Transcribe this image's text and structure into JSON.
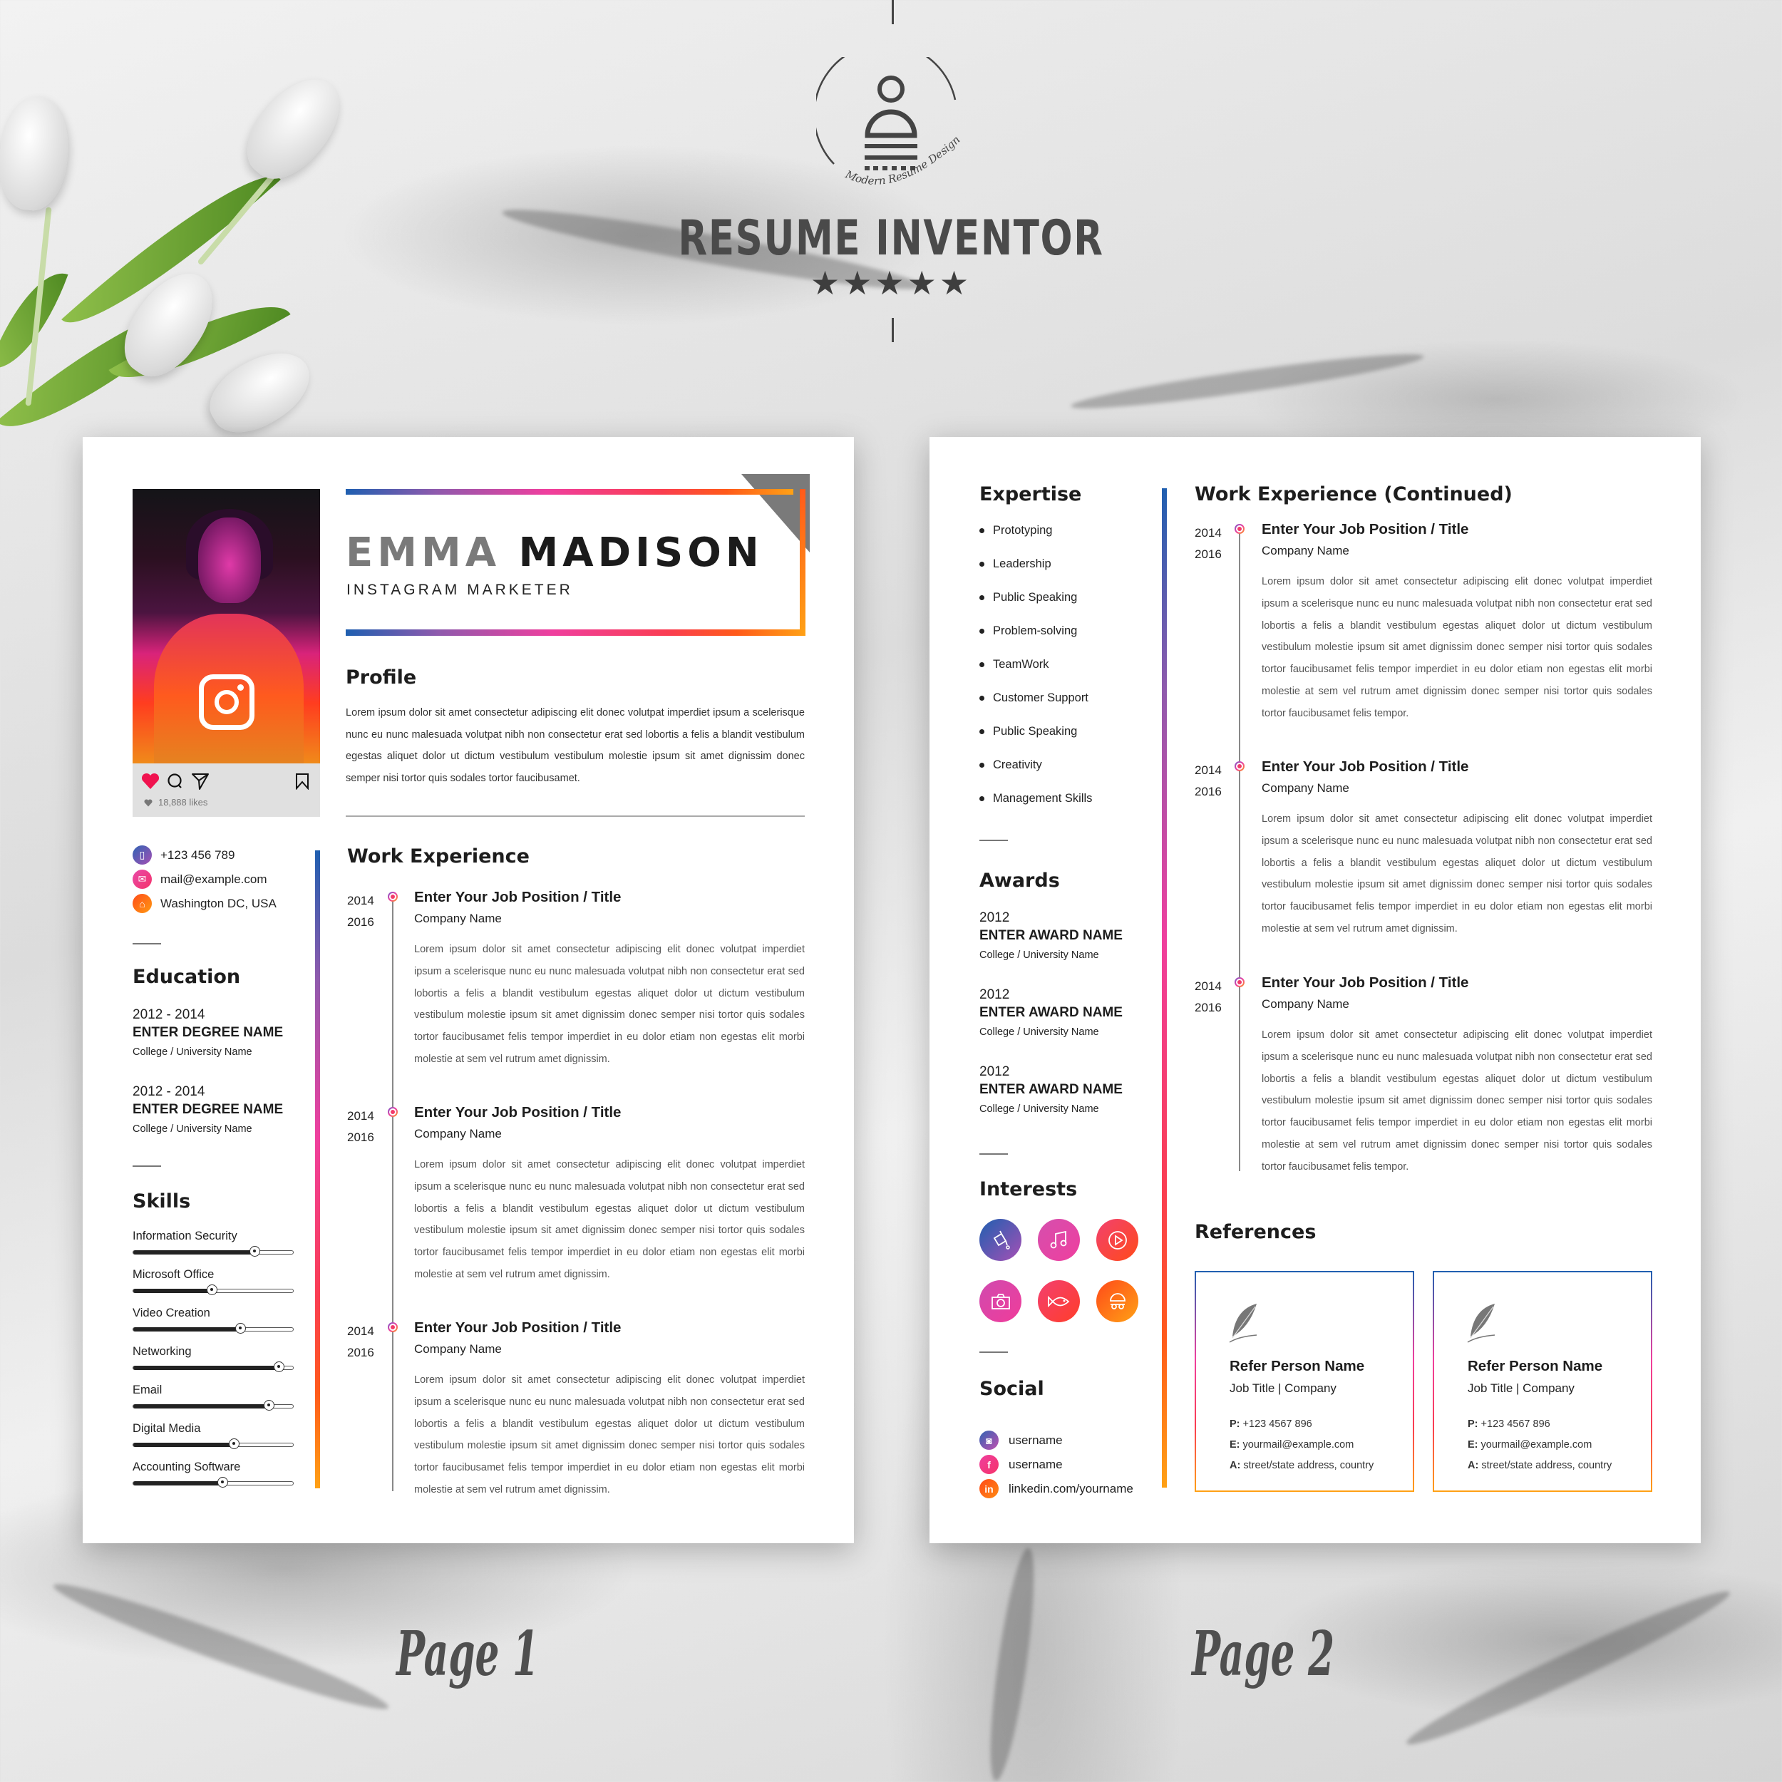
{
  "brand": {
    "logo_tagline": "Modern Resume Design",
    "title": "RESUME INVENTOR",
    "stars": "★★★★★",
    "rating": 5
  },
  "page_labels": [
    "Page 1",
    "Page 2"
  ],
  "page1": {
    "name_first": "EMMA",
    "name_last": "MADISON",
    "role": "INSTAGRAM MARKETER",
    "photo_card": {
      "likes": "18,888 likes",
      "icons": [
        "heart-icon",
        "comment-icon",
        "send-icon",
        "bookmark-icon"
      ]
    },
    "profile": {
      "heading": "Profile",
      "text": "Lorem ipsum dolor sit amet consectetur adipiscing elit donec volutpat imperdiet ipsum a scelerisque nunc eu nunc malesuada volutpat nibh non consectetur erat sed lobortis a felis a blandit vestibulum egestas aliquet dolor ut dictum vestibulum vestibulum molestie ipsum sit amet dignissim donec semper nisi tortor quis sodales tortor faucibusamet."
    },
    "contact": [
      {
        "icon": "phone-icon",
        "text": "+123 456 789"
      },
      {
        "icon": "mail-icon",
        "text": "mail@example.com"
      },
      {
        "icon": "home-icon",
        "text": "Washington DC, USA"
      }
    ],
    "education": {
      "heading": "Education",
      "items": [
        {
          "years": "2012 - 2014",
          "degree": "ENTER DEGREE NAME",
          "school": "College / University Name"
        },
        {
          "years": "2012 - 2014",
          "degree": "ENTER DEGREE NAME",
          "school": "College / University Name"
        }
      ]
    },
    "skills": {
      "heading": "Skills",
      "items": [
        {
          "label": "Information Security",
          "level_pct": 76
        },
        {
          "label": "Microsoft Office",
          "level_pct": 49
        },
        {
          "label": "Video Creation",
          "level_pct": 67
        },
        {
          "label": "Networking",
          "level_pct": 91
        },
        {
          "label": "Email",
          "level_pct": 85
        },
        {
          "label": "Digital Media",
          "level_pct": 63
        },
        {
          "label": "Accounting Software",
          "level_pct": 56
        }
      ]
    },
    "work": {
      "heading": "Work Experience",
      "jobs": [
        {
          "start": "2014",
          "end": "2016",
          "title": "Enter Your Job Position / Title",
          "company": "Company Name",
          "desc": "Lorem ipsum dolor sit amet consectetur adipiscing elit donec volutpat imperdiet ipsum a scelerisque nunc eu nunc malesuada volutpat nibh non consectetur erat sed lobortis a felis a blandit vestibulum egestas aliquet dolor ut dictum vestibulum vestibulum molestie ipsum sit amet dignissim donec semper nisi tortor quis sodales tortor faucibusamet felis tempor imperdiet in eu dolor etiam non egestas elit morbi molestie at sem vel rutrum amet dignissim."
        },
        {
          "start": "2014",
          "end": "2016",
          "title": "Enter Your Job Position / Title",
          "company": "Company Name",
          "desc": "Lorem ipsum dolor sit amet consectetur adipiscing elit donec volutpat imperdiet ipsum a scelerisque nunc eu nunc malesuada volutpat nibh non consectetur erat sed lobortis a felis a blandit vestibulum egestas aliquet dolor ut dictum vestibulum vestibulum molestie ipsum sit amet dignissim donec semper nisi tortor quis sodales tortor faucibusamet felis tempor imperdiet in eu dolor etiam non egestas elit morbi molestie at sem vel rutrum amet dignissim."
        },
        {
          "start": "2014",
          "end": "2016",
          "title": "Enter Your Job Position / Title",
          "company": "Company Name",
          "desc": "Lorem ipsum dolor sit amet consectetur adipiscing elit donec volutpat imperdiet ipsum a scelerisque nunc eu nunc malesuada volutpat nibh non consectetur erat sed lobortis a felis a blandit vestibulum egestas aliquet dolor ut dictum vestibulum vestibulum molestie ipsum sit amet dignissim donec semper nisi tortor quis sodales tortor faucibusamet felis tempor imperdiet in eu dolor etiam non egestas elit morbi molestie at sem vel rutrum amet dignissim."
        }
      ]
    }
  },
  "page2": {
    "expertise": {
      "heading": "Expertise",
      "items": [
        "Prototyping",
        "Leadership",
        "Public Speaking",
        "Problem-solving",
        "TeamWork",
        "Customer Support",
        "Public Speaking",
        "Creativity",
        "Management Skills"
      ]
    },
    "awards": {
      "heading": "Awards",
      "items": [
        {
          "year": "2012",
          "name": "ENTER AWARD NAME",
          "school": "College / University Name"
        },
        {
          "year": "2012",
          "name": "ENTER AWARD NAME",
          "school": "College / University Name"
        },
        {
          "year": "2012",
          "name": "ENTER AWARD NAME",
          "school": "College / University Name"
        }
      ]
    },
    "interests": {
      "heading": "Interests",
      "icons": [
        "paint-bucket-icon",
        "music-note-icon",
        "play-icon",
        "camera-icon",
        "fish-icon",
        "swimming-icon"
      ]
    },
    "social": {
      "heading": "Social",
      "items": [
        {
          "icon": "instagram-icon",
          "text": "username"
        },
        {
          "icon": "facebook-icon",
          "text": "username"
        },
        {
          "icon": "linkedin-icon",
          "text": "linkedin.com/yourname"
        }
      ]
    },
    "work": {
      "heading": "Work Experience (Continued)",
      "jobs": [
        {
          "start": "2014",
          "end": "2016",
          "title": "Enter Your Job Position / Title",
          "company": "Company Name",
          "desc": "Lorem ipsum dolor sit amet consectetur adipiscing elit donec volutpat imperdiet ipsum a scelerisque nunc eu nunc malesuada volutpat nibh non consectetur erat sed lobortis a felis a blandit vestibulum egestas aliquet dolor ut dictum vestibulum vestibulum molestie ipsum sit amet dignissim donec semper nisi tortor quis sodales tortor faucibusamet felis tempor imperdiet in eu dolor etiam non egestas elit morbi molestie at sem vel rutrum amet dignissim donec semper nisi tortor quis sodales tortor faucibusamet felis tempor."
        },
        {
          "start": "2014",
          "end": "2016",
          "title": "Enter Your Job Position / Title",
          "company": "Company Name",
          "desc": "Lorem ipsum dolor sit amet consectetur adipiscing elit donec volutpat imperdiet ipsum a scelerisque nunc eu nunc malesuada volutpat nibh non consectetur erat sed lobortis a felis a blandit vestibulum egestas aliquet dolor ut dictum vestibulum vestibulum molestie ipsum sit amet dignissim donec semper nisi tortor quis sodales tortor faucibusamet felis tempor imperdiet in eu dolor etiam non egestas elit morbi molestie at sem vel rutrum amet dignissim."
        },
        {
          "start": "2014",
          "end": "2016",
          "title": "Enter Your Job Position / Title",
          "company": "Company Name",
          "desc": "Lorem ipsum dolor sit amet consectetur adipiscing elit donec volutpat imperdiet ipsum a scelerisque nunc eu nunc malesuada volutpat nibh non consectetur erat sed lobortis a felis a blandit vestibulum egestas aliquet dolor ut dictum vestibulum vestibulum molestie ipsum sit amet dignissim donec semper nisi tortor quis sodales tortor faucibusamet felis tempor imperdiet in eu dolor etiam non egestas elit morbi molestie at sem vel rutrum amet dignissim donec semper nisi tortor quis sodales tortor faucibusamet felis tempor."
        }
      ]
    },
    "references": {
      "heading": "References",
      "items": [
        {
          "name": "Refer Person Name",
          "job": "Job Title | Company",
          "phone_label": "P:",
          "phone": "+123 4567 896",
          "email_label": "E:",
          "email": "yourmail@example.com",
          "address_label": "A:",
          "address": "street/state address, country"
        },
        {
          "name": "Refer Person Name",
          "job": "Job Title | Company",
          "phone_label": "P:",
          "phone": "+123 4567 896",
          "email_label": "E:",
          "email": "yourmail@example.com",
          "address_label": "A:",
          "address": "street/state address, country"
        }
      ]
    }
  },
  "colors": {
    "gradient": [
      "#1f5fb0",
      "#8e5aad",
      "#ef3f9e",
      "#fa3d52",
      "#ff5a1a",
      "#ffa115"
    ],
    "heart": "#f0124e",
    "text_dark": "#1d1d1d"
  }
}
